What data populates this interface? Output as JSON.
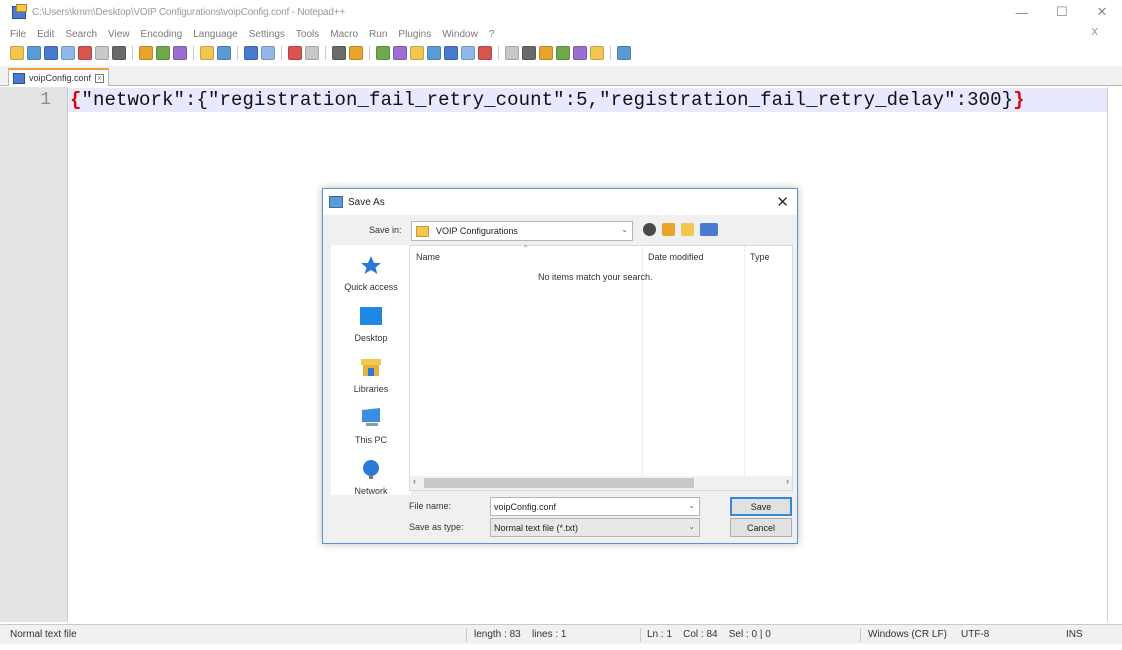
{
  "window": {
    "title": "C:\\Users\\kmm\\Desktop\\VOIP Configurations\\voipConfig.conf - Notepad++",
    "controls": [
      "—",
      "☐",
      "✕"
    ]
  },
  "menubar": {
    "items": [
      "File",
      "Edit",
      "Search",
      "View",
      "Encoding",
      "Language",
      "Settings",
      "Tools",
      "Macro",
      "Run",
      "Plugins",
      "Window",
      "?"
    ],
    "close": "X"
  },
  "toolbar": {
    "icons": [
      "new-file-icon",
      "open-file-icon",
      "save-icon",
      "save-all-icon",
      "close-icon",
      "close-all-icon",
      "print-icon",
      "cut-icon",
      "copy-icon",
      "paste-icon",
      "undo-icon",
      "redo-icon",
      "find-icon",
      "replace-icon",
      "zoom-in-icon",
      "zoom-out-icon",
      "sync-v-icon",
      "sync-h-icon",
      "word-wrap-icon",
      "all-chars-icon",
      "indent-guide-icon",
      "udl-icon",
      "doc-map-icon",
      "function-list-icon",
      "folder-workspace-icon",
      "monitoring-icon",
      "record-macro-icon",
      "stop-macro-icon",
      "play-macro-icon",
      "run-macro-icon",
      "save-macro-icon",
      "spell-check-icon"
    ]
  },
  "tab": {
    "label": "voipConfig.conf"
  },
  "editor": {
    "line_number": "1",
    "code_open": "{",
    "code_body": "\"network\":{\"registration_fail_retry_count\":5,\"registration_fail_retry_delay\":300}",
    "code_close": "}"
  },
  "statusbar": {
    "file_type": "Normal text file",
    "length": "length : 83",
    "lines": "lines : 1",
    "position": "Ln : 1    Col : 84    Sel : 0 | 0",
    "eol": "Windows (CR LF)",
    "encoding": "UTF-8",
    "mode": "INS"
  },
  "dialog": {
    "title": "Save As",
    "close": "✕",
    "save_in_label": "Save in:",
    "save_in_value": "VOIP Configurations",
    "places": [
      {
        "label": "Quick access",
        "icon": "star-icon"
      },
      {
        "label": "Desktop",
        "icon": "desktop-icon"
      },
      {
        "label": "Libraries",
        "icon": "libraries-icon"
      },
      {
        "label": "This PC",
        "icon": "this-pc-icon"
      },
      {
        "label": "Network",
        "icon": "network-icon"
      }
    ],
    "columns": [
      "Name",
      "Date modified",
      "Type"
    ],
    "empty_message": "No items match your search.",
    "file_name_label": "File name:",
    "file_name_value": "voipConfig.conf",
    "save_type_label": "Save as type:",
    "save_type_value": "Normal text file (*.txt)",
    "save_button": "Save",
    "cancel_button": "Cancel"
  },
  "colors": {
    "accent": "#3a86d6",
    "current_line": "#e8e8ff",
    "brace": "#e00000",
    "gutter": "#e4e4e4"
  }
}
